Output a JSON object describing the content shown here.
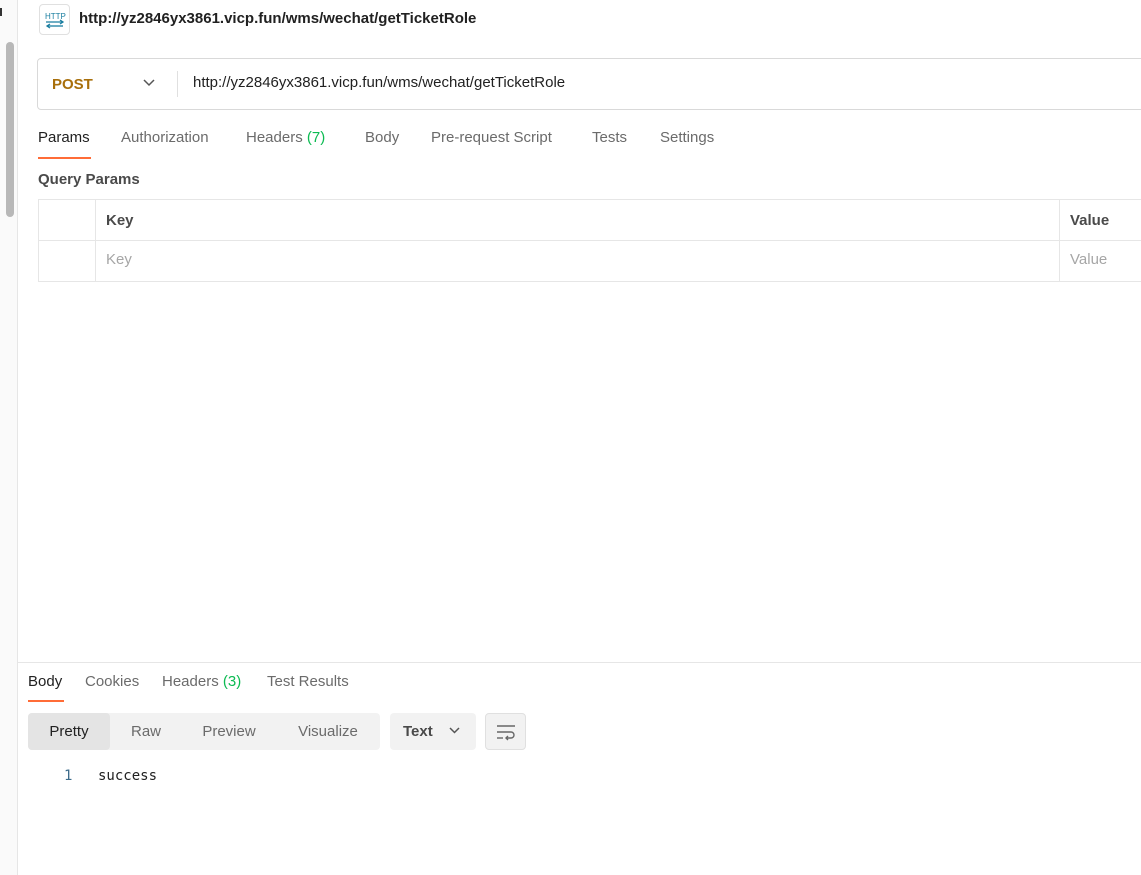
{
  "request": {
    "icon_text": "HTTP",
    "title": "http://yz2846yx3861.vicp.fun/wms/wechat/getTicketRole",
    "method": "POST",
    "url": "http://yz2846yx3861.vicp.fun/wms/wechat/getTicketRole"
  },
  "tabs": {
    "params": "Params",
    "authorization": "Authorization",
    "headers": "Headers",
    "headers_count": "(7)",
    "body": "Body",
    "prerequest": "Pre-request Script",
    "tests": "Tests",
    "settings": "Settings"
  },
  "query_params": {
    "section_label": "Query Params",
    "columns": [
      "Key",
      "Value"
    ],
    "placeholder_key": "Key",
    "placeholder_value": "Value"
  },
  "response": {
    "tabs": {
      "body": "Body",
      "cookies": "Cookies",
      "headers": "Headers",
      "headers_count": "(3)",
      "test_results": "Test Results"
    },
    "views": [
      "Pretty",
      "Raw",
      "Preview",
      "Visualize"
    ],
    "active_view": "Pretty",
    "format": "Text",
    "lines": [
      {
        "num": "1",
        "text": "success"
      }
    ]
  },
  "colors": {
    "accent": "#ff6c37",
    "method_post": "#a86f0b",
    "count_green": "#0cbb52"
  }
}
